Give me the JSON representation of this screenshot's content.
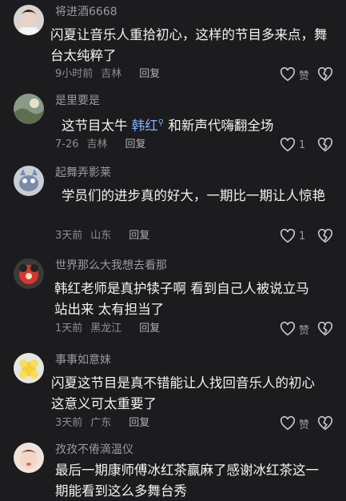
{
  "comments": [
    {
      "username": "将进酒6668",
      "content": "闪夏让音乐人重拾初心，这样的节目多来点，舞台太纯粹了",
      "time": "9小时前",
      "location": "吉林",
      "reply_label": "回复",
      "like_label": "赞"
    },
    {
      "username": "是里要是",
      "content_before": "这节目太牛 ",
      "mention": "韩红",
      "content_after": " 和新声代嗨翻全场",
      "time": "7-26",
      "location": "吉林",
      "reply_label": "回复",
      "like_label": "1"
    },
    {
      "username": "起舞弄影莱",
      "content": "学员们的进步真的好大，一期比一期让人惊艳",
      "time": "3天前",
      "location": "山东",
      "reply_label": "回复",
      "like_label": "1"
    },
    {
      "username": "世界那么大我想去看那",
      "content": "韩红老师是真护犊子啊 看到自己人被说立马站出来 太有担当了",
      "time": "1天前",
      "location": "黑龙江",
      "reply_label": "回复",
      "like_label": "赞"
    },
    {
      "username": "事事如意妹",
      "content": "闪夏这节目是真不错能让人找回音乐人的初心这意义可太重要了",
      "time": "3天前",
      "location": "广东",
      "reply_label": "回复",
      "like_label": "赞"
    },
    {
      "username": "孜孜不倦滴温仪",
      "content": "最后一期康师傅冰红茶赢麻了感谢冰红茶这一期能看到这么多舞台秀"
    }
  ],
  "icons": {
    "like": "heart-outline-icon",
    "dislike": "broken-heart-icon"
  }
}
